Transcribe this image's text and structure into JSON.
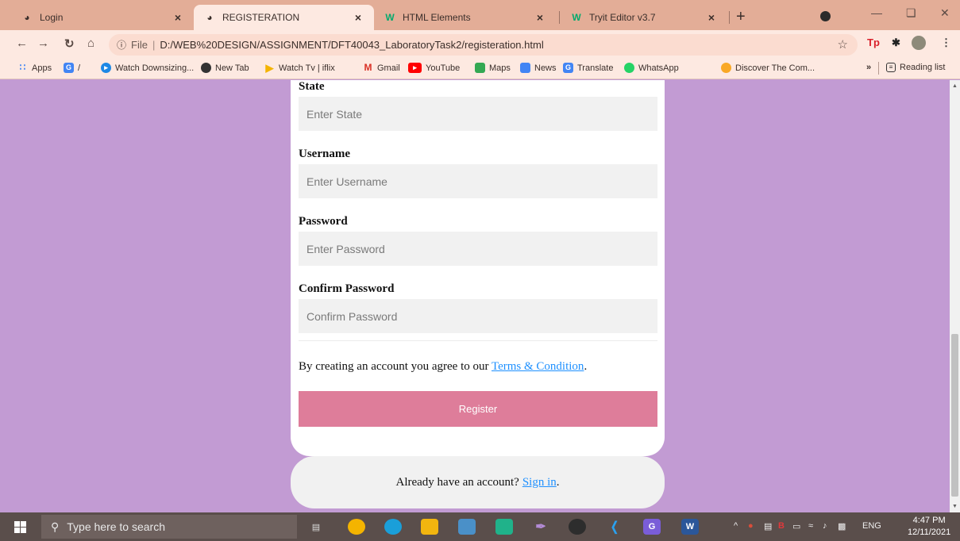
{
  "browser": {
    "tabs": [
      {
        "title": "Login",
        "icon": "globe-icon"
      },
      {
        "title": "REGISTERATION",
        "icon": "globe-icon",
        "active": true
      },
      {
        "title": "HTML Elements",
        "icon": "w3schools-icon"
      },
      {
        "title": "Tryit Editor v3.7",
        "icon": "w3schools-icon"
      }
    ],
    "address": {
      "scheme": "File",
      "url": "D:/WEB%20DESIGN/ASSIGNMENT/DFT40043_LaboratoryTask2/registeration.html"
    },
    "bookmarks": [
      {
        "label": "Apps",
        "icon": "apps-grid-icon",
        "color": "#4285f4"
      },
      {
        "label": "/",
        "icon": "translate-icon",
        "color": "#4285f4"
      },
      {
        "label": "Watch Downsizing...",
        "icon": "play-circle-icon",
        "color": "#1e88e5"
      },
      {
        "label": "New Tab",
        "icon": "globe-icon",
        "color": "#333333"
      },
      {
        "label": "Watch Tv | iflix",
        "icon": "play-icon",
        "color": "#f4b400"
      },
      {
        "label": "Gmail",
        "icon": "gmail-icon",
        "color": "#d93025"
      },
      {
        "label": "YouTube",
        "icon": "youtube-icon",
        "color": "#ff0000"
      },
      {
        "label": "Maps",
        "icon": "maps-icon",
        "color": "#34a853"
      },
      {
        "label": "News",
        "icon": "news-icon",
        "color": "#4285f4"
      },
      {
        "label": "Translate",
        "icon": "translate-icon",
        "color": "#4285f4"
      },
      {
        "label": "WhatsApp",
        "icon": "whatsapp-icon",
        "color": "#25d366"
      },
      {
        "label": "Discover The Com...",
        "icon": "discover-icon",
        "color": "#f9a825"
      }
    ],
    "reading_list": "Reading list",
    "overflow": "»"
  },
  "form": {
    "state_label": "State",
    "state_placeholder": "Enter State",
    "username_label": "Username",
    "username_placeholder": "Enter Username",
    "password_label": "Password",
    "password_placeholder": "Enter Password",
    "confirm_label": "Confirm Password",
    "confirm_placeholder": "Confirm Password",
    "agree_text": "By creating an account you agree to our",
    "terms_link": "Terms & Condition",
    "agree_end": ".",
    "register_button": "Register",
    "signin_text": "Already have an account?",
    "signin_link": "Sign in",
    "signin_end": "."
  },
  "taskbar": {
    "search_placeholder": "Type here to search",
    "lang": "ENG",
    "time": "4:47 PM",
    "date": "12/11/2021"
  },
  "colors": {
    "page_background": "#c29bd3",
    "register_button": "#de7d9a",
    "link": "#1e90ff",
    "tab_strip": "#e3ad97"
  }
}
